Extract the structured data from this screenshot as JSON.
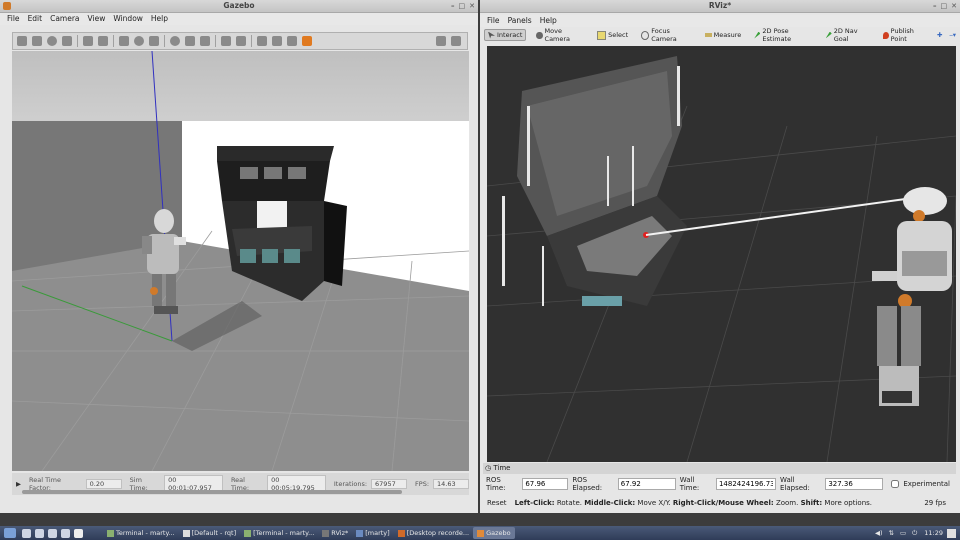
{
  "gazebo": {
    "title": "Gazebo",
    "menu": [
      "File",
      "Edit",
      "Camera",
      "View",
      "Window",
      "Help"
    ],
    "status": {
      "rtf_label": "Real Time Factor:",
      "rtf_value": "0.20",
      "sim_label": "Sim Time:",
      "sim_value": "00 00:01:07.957",
      "real_label": "Real Time:",
      "real_value": "00 00:05:19.795",
      "iter_label": "Iterations:",
      "iter_value": "67957",
      "fps_label": "FPS:",
      "fps_value": "14.63"
    }
  },
  "rviz": {
    "title": "RViz*",
    "menu": [
      "File",
      "Panels",
      "Help"
    ],
    "tools": [
      "Interact",
      "Move Camera",
      "Select",
      "Focus Camera",
      "Measure",
      "2D Pose Estimate",
      "2D Nav Goal",
      "Publish Point"
    ],
    "time_panel": {
      "header": "Time",
      "ros_time_label": "ROS Time:",
      "ros_time": "67.96",
      "ros_elapsed_label": "ROS Elapsed:",
      "ros_elapsed": "67.92",
      "wall_time_label": "Wall Time:",
      "wall_time": "1482424196.73",
      "wall_elapsed_label": "Wall Elapsed:",
      "wall_elapsed": "327.36",
      "experimental": "Experimental"
    },
    "bottom": {
      "reset": "Reset",
      "hint_b1": "Left-Click:",
      "hint_t1": " Rotate. ",
      "hint_b2": "Middle-Click:",
      "hint_t2": " Move X/Y. ",
      "hint_b3": "Right-Click/Mouse Wheel:",
      "hint_t3": " Zoom. ",
      "hint_b4": "Shift:",
      "hint_t4": " More options.",
      "fps": "29 fps"
    }
  },
  "taskbar": {
    "tasks": [
      "Terminal - marty...",
      "[Default - rqt]",
      "[Terminal - marty...",
      "RViz*",
      "[marty]",
      "[Desktop recorde...",
      "Gazebo"
    ],
    "clock": "11:29"
  }
}
